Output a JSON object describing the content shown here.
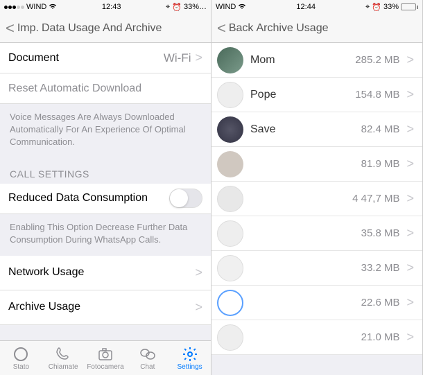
{
  "left": {
    "status": {
      "carrier": "WIND",
      "time": "12:43",
      "batt_pct": "33%…"
    },
    "nav": {
      "back": "Imp.",
      "title": "Data Usage And Archive"
    },
    "rows": {
      "document": "Document",
      "wifi": "Wi-Fi",
      "reset": "Reset Automatic Download",
      "voice_info": "Voice Messages Are Always Downloaded Automatically For An Experience Of Optimal Communication.",
      "call_header": "CALL SETTINGS",
      "reduced": "Reduced Data Consumption",
      "reduced_info": "Enabling This Option Decrease Further Data Consumption During WhatsApp Calls.",
      "network": "Network Usage",
      "archive": "Archive Usage"
    },
    "tabs": {
      "stato": "Stato",
      "chiamate": "Chiamate",
      "foto": "Fotocamera",
      "chat": "Chat",
      "settings": "Settings"
    }
  },
  "right": {
    "status": {
      "carrier": "WIND",
      "time": "12:44",
      "batt_pct": "33%"
    },
    "nav": {
      "back": "Back",
      "title": "Archive Usage"
    },
    "chats": [
      {
        "name": "Mom",
        "size": "285.2 MB"
      },
      {
        "name": "Pope",
        "size": "154.8 MB"
      },
      {
        "name": "Save",
        "size": "82.4 MB"
      },
      {
        "name": "",
        "size": "81.9 MB"
      },
      {
        "name": "",
        "size": "4 47,7 MB"
      },
      {
        "name": "",
        "size": "35.8 MB"
      },
      {
        "name": "",
        "size": "33.2 MB"
      },
      {
        "name": "",
        "size": "22.6 MB"
      },
      {
        "name": "",
        "size": "21.0 MB"
      }
    ]
  }
}
